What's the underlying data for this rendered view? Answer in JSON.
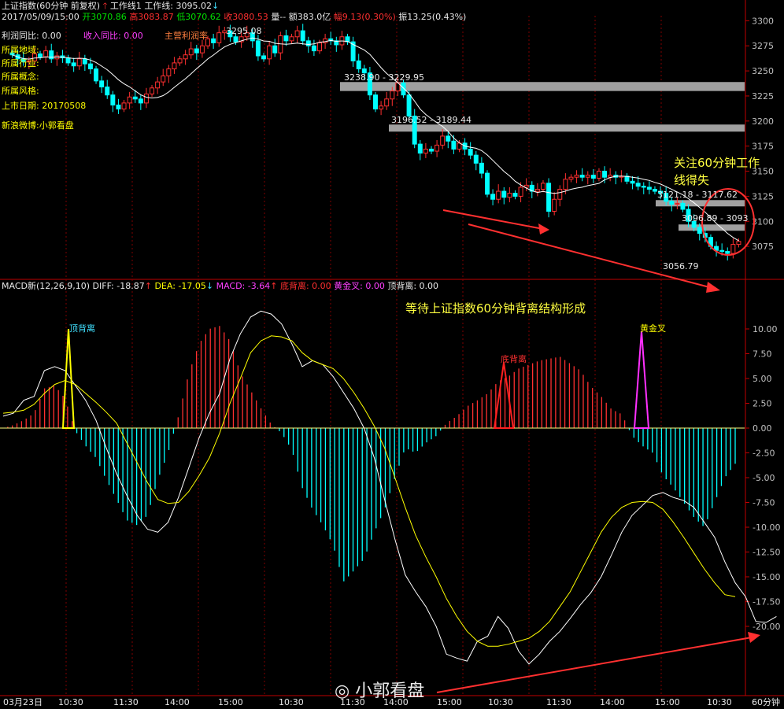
{
  "header": {
    "title": "上证指数(60分钟 前复权)",
    "work_line_label": "工作线1",
    "work_line_value": "工作线: 3095.02",
    "datetime": "2017/05/09/15:00",
    "open": "开3070.86",
    "high": "高3083.87",
    "low": "低3070.62",
    "close": "收3080.53",
    "volume": "量--",
    "amount": "额383.0亿",
    "change": "幅9.13(0.30%)",
    "amplitude": "振13.25(0.43%)"
  },
  "info_panel": {
    "profit_yoy": "利润同比:  0.00",
    "revenue_yoy": "收入同比:  0.00",
    "main_profit": "主营利润率",
    "region": "所属地域:",
    "industry": "所属行业:",
    "concept": "所属概念:",
    "style": "所属风格:",
    "listing_date": "上市日期:  20170508",
    "weibo": "新浪微博:小郭看盘"
  },
  "annotations": {
    "focus_line1": "关注60分钟工作",
    "focus_line2": "线得失",
    "wait_text": "等待上证指数60分钟背离结构形成",
    "zone1": "3238.90 - 3229.95",
    "zone2": "3196.52 - 3189.44",
    "zone3": "3121.18 - 3117.62",
    "zone4": "3096.89 - 3093",
    "peak": "3295.08",
    "low_label": "3056.79",
    "top_div": "顶背离",
    "bottom_div": "底背离",
    "golden_cross": "黄金叉"
  },
  "macd_header": {
    "name": "MACD新(12,26,9,10)",
    "diff": "DIFF: -18.87",
    "dea": "DEA: -17.05",
    "macd": "MACD: -3.64",
    "bottom_div": "底背离: 0.00",
    "golden": "黄金叉: 0.00",
    "top_div": "顶背离: 0.00"
  },
  "time_axis": [
    "03月23日",
    "10:30",
    "11:30",
    "14:00",
    "15:00",
    "10:30",
    "11:30",
    "14:00",
    "15:00",
    "10:30",
    "11:30",
    "14:00",
    "15:00",
    "10:30"
  ],
  "period_label": "60分钟",
  "watermark": "小郭看盘",
  "colors": {
    "up": "#ff3030",
    "down": "#00ffff",
    "ma": "#ffffff",
    "dea": "#ffff00",
    "zone": "#a0a0a0",
    "grid": "#800000"
  },
  "chart_data": [
    {
      "type": "candlestick",
      "title": "上证指数(60分钟 前复权)",
      "y_ticks": [
        3300,
        3275,
        3250,
        3225,
        3200,
        3175,
        3150,
        3125,
        3100,
        3075
      ],
      "ylim": [
        3050,
        3305
      ],
      "resistance_zones": [
        [
          3229.95,
          3238.9
        ],
        [
          3189.44,
          3196.52
        ],
        [
          3117.62,
          3121.18
        ],
        [
          3093,
          3096.89
        ]
      ],
      "close": [
        3266,
        3262,
        3259,
        3260,
        3267,
        3264,
        3270,
        3262,
        3265,
        3263,
        3258,
        3255,
        3262,
        3257,
        3252,
        3240,
        3234,
        3226,
        3216,
        3212,
        3218,
        3224,
        3222,
        3218,
        3227,
        3233,
        3239,
        3245,
        3252,
        3258,
        3262,
        3266,
        3272,
        3268,
        3275,
        3282,
        3278,
        3288,
        3290,
        3284,
        3279,
        3284,
        3288,
        3280,
        3265,
        3262,
        3275,
        3268,
        3285,
        3280,
        3284,
        3290,
        3280,
        3275,
        3270,
        3278,
        3282,
        3280,
        3276,
        3284,
        3279,
        3260,
        3252,
        3248,
        3226,
        3212,
        3215,
        3222,
        3230,
        3238,
        3226,
        3205,
        3177,
        3168,
        3172,
        3170,
        3176,
        3185,
        3180,
        3172,
        3178,
        3172,
        3166,
        3158,
        3148,
        3127,
        3122,
        3130,
        3124,
        3128,
        3125,
        3134,
        3136,
        3130,
        3132,
        3138,
        3110,
        3122,
        3132,
        3142,
        3144,
        3146,
        3144,
        3146,
        3143,
        3150,
        3144,
        3146,
        3144,
        3145,
        3140,
        3138,
        3135,
        3134,
        3132,
        3130,
        3128,
        3120,
        3117,
        3118,
        3112,
        3100,
        3094,
        3088,
        3084,
        3075,
        3071,
        3070,
        3068,
        3077,
        3080
      ]
    },
    {
      "type": "bar",
      "title": "MACD新(12,26,9,10)",
      "y_ticks": [
        10,
        7.5,
        5,
        2.5,
        0,
        -2.5,
        -5,
        -7.5,
        -10,
        -12.5,
        -15,
        -17.5,
        -20
      ],
      "ylim": [
        -22.5,
        12.5
      ],
      "series": [
        {
          "name": "DIFF",
          "values": [
            1.2,
            1.5,
            2.8,
            3.2,
            5.8,
            6.2,
            5.8,
            4.3,
            2.8,
            0.8,
            -2.0,
            -4.6,
            -6.8,
            -8.8,
            -10.2,
            -10.5,
            -9.5,
            -7.0,
            -4.0,
            -1.0,
            1.5,
            3.5,
            7.0,
            9.5,
            11.2,
            11.8,
            11.5,
            10.5,
            8.5,
            6.2,
            6.8,
            6.4,
            5.2,
            3.6,
            2.0,
            0.0,
            -3.0,
            -7.2,
            -11.2,
            -14.8,
            -16.5,
            -18.0,
            -20.0,
            -22.8,
            -23.2,
            -23.5,
            -21.5,
            -21.0,
            -19.0,
            -20.2,
            -22.5,
            -23.8,
            -22.8,
            -21.5,
            -20.5,
            -19.2,
            -17.8,
            -16.6,
            -15.0,
            -12.8,
            -10.5,
            -8.8,
            -7.8,
            -6.8,
            -6.5,
            -7.0,
            -7.3,
            -8.0,
            -9.5,
            -11.0,
            -13.5,
            -15.6,
            -17.0,
            -19.5,
            -19.6,
            -19.0
          ]
        },
        {
          "name": "DEA",
          "values": [
            1.5,
            1.6,
            1.8,
            2.4,
            3.5,
            4.4,
            4.8,
            4.4,
            3.5,
            2.6,
            1.6,
            0.5,
            -1.5,
            -3.5,
            -5.5,
            -7.2,
            -7.6,
            -7.5,
            -6.4,
            -4.8,
            -3.0,
            -0.5,
            2.5,
            5.0,
            7.6,
            8.8,
            9.3,
            9.2,
            8.8,
            7.6,
            6.8,
            6.4,
            6.0,
            5.0,
            3.6,
            2.0,
            0.2,
            -2.0,
            -5.0,
            -8.0,
            -10.8,
            -13.0,
            -15.0,
            -17.2,
            -19.0,
            -20.5,
            -21.5,
            -22.0,
            -22.0,
            -21.8,
            -21.5,
            -21.2,
            -20.5,
            -19.5,
            -18.0,
            -16.5,
            -14.5,
            -12.5,
            -10.5,
            -9.0,
            -8.0,
            -7.5,
            -7.4,
            -7.5,
            -8.2,
            -9.5,
            -11.0,
            -12.6,
            -14.2,
            -15.6,
            -16.8,
            -17.0
          ]
        },
        {
          "name": "MACD",
          "values": [
            0.0,
            0.3,
            0.8,
            1.5,
            4.0,
            4.3,
            3.0,
            -0.3,
            -1.8,
            -3.0,
            -5.2,
            -7.2,
            -9.3,
            -9.8,
            -8.8,
            -5.2,
            -2.5,
            1.2,
            5.5,
            8.5,
            10.0,
            10.3,
            8.8,
            5.6,
            3.8,
            2.0,
            0.4,
            -0.5,
            -2.2,
            -6.0,
            -8.2,
            -9.8,
            -11.8,
            -15.5,
            -14.4,
            -13.2,
            -10.5,
            -8.2,
            -5.0,
            -2.0,
            -2.5,
            -1.5,
            -0.8,
            0.5,
            1.2,
            2.2,
            2.8,
            3.5,
            4.7,
            5.2,
            6.0,
            6.4,
            6.8,
            7.0,
            7.2,
            6.5,
            5.8,
            4.2,
            3.2,
            1.9,
            1.4,
            -0.8,
            -1.8,
            -2.5,
            -4.8,
            -6.0,
            -7.5,
            -9.0,
            -10.0,
            -7.5,
            -5.0,
            -3.6
          ]
        }
      ]
    }
  ]
}
